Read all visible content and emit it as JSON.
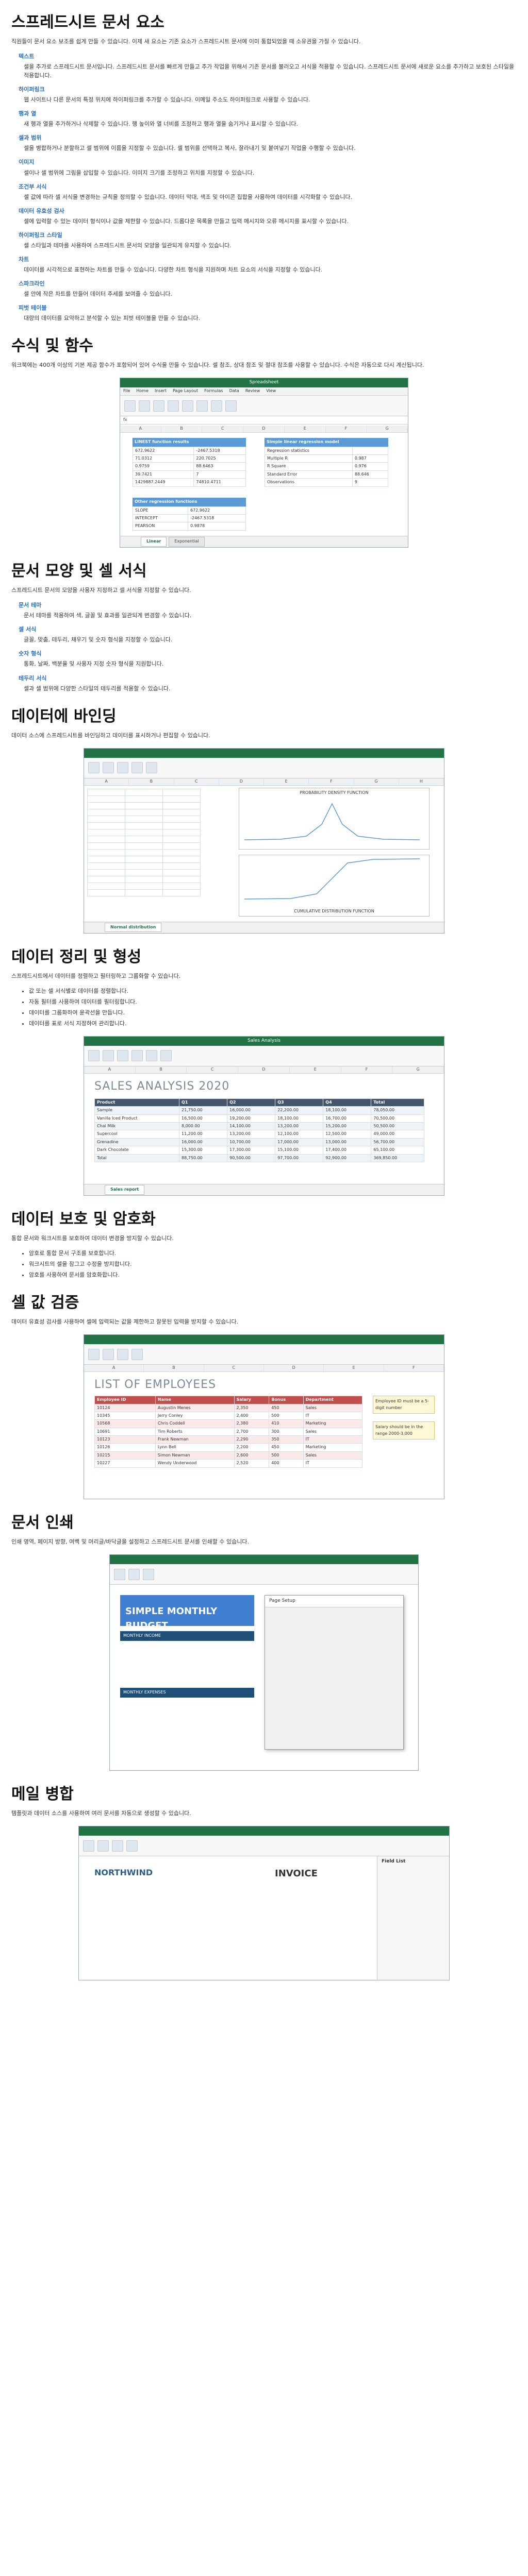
{
  "sections": {
    "s1": {
      "title": "스프레드시트 문서 요소",
      "intro": "직원들이 문서 요소 보조를 쉽게 만들 수 있습니다. 이제 새 요소는 기존 요소가 스프레드시트 문서에 이미 통합되었을 때 소유권을 가질 수 있습니다.",
      "features": [
        {
          "t": "텍스트",
          "d": "셀을 추가로 스프레드시트 문서입니다. 스프레드시트 문서를 빠르게 만들고 추가 작업을 위해서 기존 문서를 불러오고 서식을 적용할 수 있습니다. 스프레드시트 문서에 새로운 요소를 추가하고 보호된 스타일을 적용합니다."
        },
        {
          "t": "하이퍼링크",
          "d": "웹 사이트나 다른 문서의 특정 위치에 하이퍼링크를 추가할 수 있습니다. 이메일 주소도 하이퍼링크로 사용할 수 있습니다."
        },
        {
          "t": "행과 열",
          "d": "새 행과 열을 추가하거나 삭제할 수 있습니다. 행 높이와 열 너비를 조정하고 행과 열을 숨기거나 표시할 수 있습니다."
        },
        {
          "t": "셀과 범위",
          "d": "셀을 병합하거나 분할하고 셀 범위에 이름을 지정할 수 있습니다. 셀 범위를 선택하고 복사, 잘라내기 및 붙여넣기 작업을 수행할 수 있습니다."
        },
        {
          "t": "이미지",
          "d": "셀이나 셀 범위에 그림을 삽입할 수 있습니다. 이미지 크기를 조정하고 위치를 지정할 수 있습니다."
        },
        {
          "t": "조건부 서식",
          "d": "셀 값에 따라 셀 서식을 변경하는 규칙을 정의할 수 있습니다. 데이터 막대, 색조 및 아이콘 집합을 사용하여 데이터를 시각화할 수 있습니다."
        },
        {
          "t": "데이터 유효성 검사",
          "d": "셀에 입력할 수 있는 데이터 형식이나 값을 제한할 수 있습니다. 드롭다운 목록을 만들고 입력 메시지와 오류 메시지를 표시할 수 있습니다."
        },
        {
          "t": "하이퍼링크 스타일",
          "d": "셀 스타일과 테마를 사용하여 스프레드시트 문서의 모양을 일관되게 유지할 수 있습니다."
        },
        {
          "t": "차트",
          "d": "데이터를 시각적으로 표현하는 차트를 만들 수 있습니다. 다양한 차트 형식을 지원하며 차트 요소의 서식을 지정할 수 있습니다."
        },
        {
          "t": "스파크라인",
          "d": "셀 안에 작은 차트를 만들어 데이터 추세를 보여줄 수 있습니다."
        },
        {
          "t": "피벗 테이블",
          "d": "대량의 데이터를 요약하고 분석할 수 있는 피벗 테이블을 만들 수 있습니다."
        }
      ]
    },
    "s2": {
      "title": "수식 및 함수",
      "intro": "워크북에는 400개 이상의 기본 제공 함수가 포함되어 있어 수식을 만들 수 있습니다. 셀 참조, 상대 참조 및 절대 참조를 사용할 수 있습니다. 수식은 자동으로 다시 계산됩니다."
    },
    "s3": {
      "title": "문서 모양 및 셀 서식",
      "intro": "스프레드시트 문서의 모양을 사용자 지정하고 셀 서식을 지정할 수 있습니다.",
      "features": [
        {
          "t": "문서 테마",
          "d": "문서 테마를 적용하여 색, 글꼴 및 효과를 일관되게 변경할 수 있습니다."
        },
        {
          "t": "셀 서식",
          "d": "글꼴, 맞춤, 테두리, 채우기 및 숫자 형식을 지정할 수 있습니다."
        },
        {
          "t": "숫자 형식",
          "d": "통화, 날짜, 백분율 및 사용자 지정 숫자 형식을 지원합니다."
        },
        {
          "t": "테두리 서식",
          "d": "셀과 셀 범위에 다양한 스타일의 테두리를 적용할 수 있습니다."
        }
      ]
    },
    "s4": {
      "title": "데이터에 바인딩",
      "intro": "데이터 소스에 스프레드시트를 바인딩하고 데이터를 표시하거나 편집할 수 있습니다."
    },
    "s5": {
      "title": "데이터 정리 및 형성",
      "intro": "스프레드시트에서 데이터를 정렬하고 필터링하고 그룹화할 수 있습니다.",
      "bullets": [
        "값 또는 셀 서식별로 데이터를 정렬합니다.",
        "자동 필터를 사용하여 데이터를 필터링합니다.",
        "데이터를 그룹화하여 윤곽선을 만듭니다.",
        "데이터를 표로 서식 지정하여 관리합니다."
      ]
    },
    "s6": {
      "title": "데이터 보호 및 암호화",
      "intro": "통합 문서와 워크시트를 보호하여 데이터 변경을 방지할 수 있습니다.",
      "bullets": [
        "암호로 통합 문서 구조를 보호합니다.",
        "워크시트의 셀을 잠그고 수정을 방지합니다.",
        "암호를 사용하여 문서를 암호화합니다."
      ]
    },
    "s7": {
      "title": "셀 값 검증",
      "intro": "데이터 유효성 검사를 사용하여 셀에 입력되는 값을 제한하고 잘못된 입력을 방지할 수 있습니다."
    },
    "s8": {
      "title": "문서 인쇄",
      "intro": "인쇄 영역, 페이지 방향, 여백 및 머리글/바닥글을 설정하고 스프레드시트 문서를 인쇄할 수 있습니다."
    },
    "s9": {
      "title": "메일 병합",
      "intro": "템플릿과 데이터 소스를 사용하여 여러 문서를 자동으로 생성할 수 있습니다."
    }
  },
  "shots": {
    "formula": {
      "title": "Spreadsheet",
      "menu": [
        "File",
        "Home",
        "Insert",
        "Page Layout",
        "Formulas",
        "Data",
        "Review",
        "View"
      ],
      "sheet_tabs": [
        "Linear",
        "Exponential"
      ],
      "left_title": "LINEST function results",
      "right_title": "Simple linear regression model",
      "left_rows": [
        [
          "672.9622",
          "-2467.5318"
        ],
        [
          "71.0312",
          "220.7025"
        ],
        [
          "0.9759",
          "88.6463"
        ],
        [
          "39.7421",
          "7"
        ],
        [
          "1429887.2449",
          "74810.4711"
        ]
      ],
      "right_rows": [
        [
          "Regression statistics",
          ""
        ],
        [
          "Multiple R",
          "0.987"
        ],
        [
          "R Square",
          "0.976"
        ],
        [
          "Standard Error",
          "88.646"
        ],
        [
          "Observations",
          "9"
        ]
      ],
      "bottom_title": "Other regression functions",
      "bottom_rows": [
        [
          "SLOPE",
          "672.9622"
        ],
        [
          "INTERCEPT",
          "-2467.5318"
        ],
        [
          "PEARSON",
          "0.9878"
        ]
      ]
    },
    "theme": {
      "title": "Sales Analysis",
      "heading": "SALES ANALYSIS 2020",
      "cols": [
        "Product",
        "Q1",
        "Q2",
        "Q3",
        "Q4",
        "Total"
      ],
      "rows": [
        [
          "Sample",
          "21,750.00",
          "16,000.00",
          "22,200.00",
          "18,100.00",
          "78,050.00"
        ],
        [
          "Vanilla Iced Product",
          "16,500.00",
          "19,200.00",
          "18,100.00",
          "16,700.00",
          "70,500.00"
        ],
        [
          "Chai Milk",
          "8,000.00",
          "14,100.00",
          "13,200.00",
          "15,200.00",
          "50,500.00"
        ],
        [
          "Supercool",
          "11,200.00",
          "13,200.00",
          "12,100.00",
          "12,500.00",
          "49,000.00"
        ],
        [
          "Grenadine",
          "16,000.00",
          "10,700.00",
          "17,000.00",
          "13,000.00",
          "56,700.00"
        ],
        [
          "Dark Chocolate",
          "15,300.00",
          "17,300.00",
          "15,100.00",
          "17,400.00",
          "65,100.00"
        ],
        [
          "Total",
          "88,750.00",
          "90,500.00",
          "97,700.00",
          "92,900.00",
          "369,850.00"
        ]
      ],
      "sheet_tabs": [
        "Sales report"
      ]
    },
    "binding": {
      "chart1": "PROBABILITY DENSITY FUNCTION",
      "chart2": "CUMULATIVE DISTRIBUTION FUNCTION",
      "sheet_tabs": [
        "Normal distribution"
      ]
    },
    "employees": {
      "heading": "LIST OF EMPLOYEES",
      "cols": [
        "Employee ID",
        "Name",
        "Salary",
        "Bonus",
        "Department"
      ],
      "rows": [
        [
          "10124",
          "Augustin Menes",
          "2,350",
          "450",
          "Sales"
        ],
        [
          "10345",
          "Jerry Conley",
          "2,400",
          "500",
          "IT"
        ],
        [
          "10568",
          "Chris Coddell",
          "2,380",
          "410",
          "Marketing"
        ],
        [
          "10691",
          "Tim Roberts",
          "2,700",
          "300",
          "Sales"
        ],
        [
          "10123",
          "Frank Newman",
          "2,290",
          "350",
          "IT"
        ],
        [
          "10126",
          "Lynn Bell",
          "2,200",
          "450",
          "Marketing"
        ],
        [
          "10215",
          "Simon Newman",
          "2,600",
          "500",
          "Sales"
        ],
        [
          "10227",
          "Wendy Underwood",
          "2,520",
          "400",
          "IT"
        ]
      ],
      "note1": "Employee ID must be a 5-digit number",
      "note2": "Salary should be in the range 2000-3,000"
    },
    "print": {
      "title": "SIMPLE MONTHLY BUDGET",
      "income": "MONTHLY INCOME",
      "expenses": "MONTHLY EXPENSES",
      "dialog_title": "Page Setup"
    },
    "mail": {
      "company": "NORTHWIND",
      "invoice": "INVOICE",
      "field_list": "Field List"
    }
  }
}
